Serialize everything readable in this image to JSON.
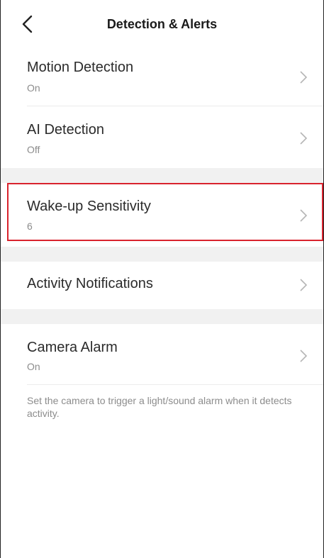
{
  "header": {
    "title": "Detection & Alerts",
    "back_icon": "chevron-left-icon"
  },
  "settings": {
    "motion_detection": {
      "label": "Motion Detection",
      "value": "On"
    },
    "ai_detection": {
      "label": "AI Detection",
      "value": "Off"
    },
    "wakeup_sensitivity": {
      "label": "Wake-up Sensitivity",
      "value": "6"
    },
    "activity_notifications": {
      "label": "Activity Notifications"
    },
    "camera_alarm": {
      "label": "Camera Alarm",
      "value": "On"
    }
  },
  "footnote": "Set the camera to trigger a light/sound alarm when it detects activity.",
  "colors": {
    "highlight": "#d9232d",
    "section_gap": "#f1f1f1",
    "secondary_text": "#8c8c8c"
  }
}
